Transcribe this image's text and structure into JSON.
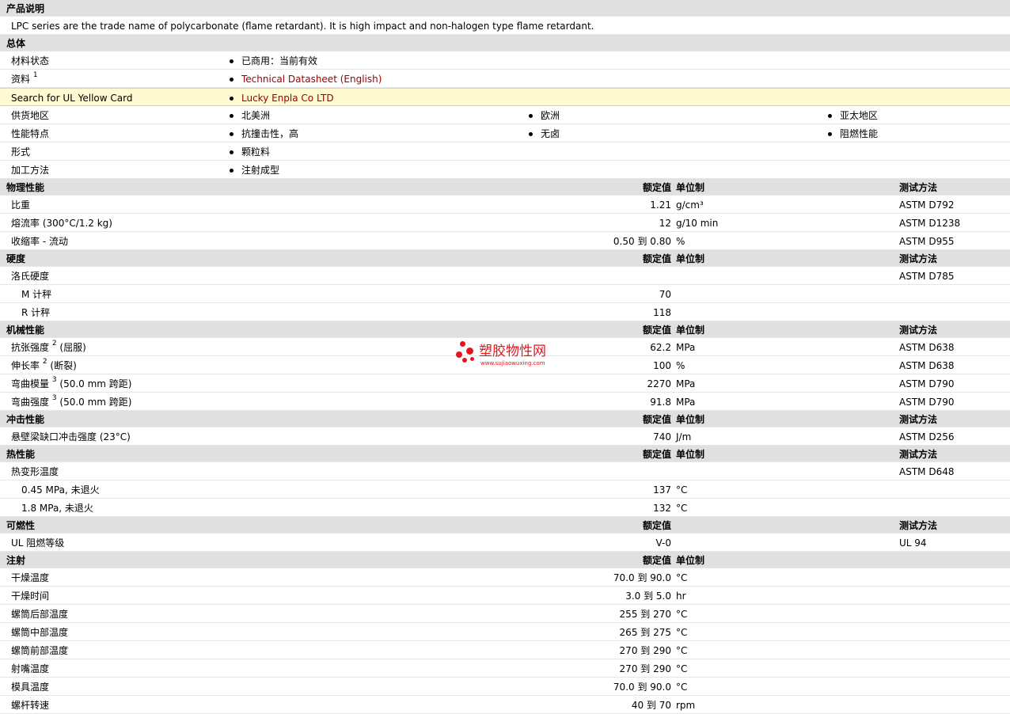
{
  "overview": {
    "title": "产品说明",
    "text": "LPC series are the trade name of polycarbonate (flame retardant). It is high impact and non-halogen type flame retardant."
  },
  "general": {
    "title": "总体",
    "material_status_label": "材料状态",
    "material_status_value": "已商用：当前有效",
    "doc_label": "资料",
    "doc_sup": "1",
    "doc_link": "Technical Datasheet (English)",
    "ul_label": "Search for UL Yellow Card",
    "ul_link": "Lucky Enpla Co LTD",
    "supply_label": "供货地区",
    "supply": [
      "北美洲",
      "欧洲",
      "亚太地区"
    ],
    "features_label": "性能特点",
    "features": [
      "抗撞击性，高",
      "无卤",
      "阻燃性能"
    ],
    "form_label": "形式",
    "form_value": "颗粒料",
    "process_label": "加工方法",
    "process_value": "注射成型"
  },
  "headers": {
    "value": "额定值",
    "unit": "单位制",
    "method": "测试方法"
  },
  "physical": {
    "title": "物理性能",
    "rows": [
      {
        "label": "比重",
        "value": "1.21",
        "unit": "g/cm³",
        "method": "ASTM D792"
      },
      {
        "label": "熔流率  (300°C/1.2 kg)",
        "value": "12",
        "unit": "g/10 min",
        "method": "ASTM D1238"
      },
      {
        "label": "收缩率  - 流动",
        "value": "0.50 到  0.80",
        "unit": "%",
        "method": "ASTM D955"
      }
    ]
  },
  "hardness": {
    "title": "硬度",
    "label": "洛氏硬度",
    "method": "ASTM D785",
    "rows": [
      {
        "label": "M 计秤",
        "value": "70"
      },
      {
        "label": "R 计秤",
        "value": "118"
      }
    ]
  },
  "mechanical": {
    "title": "机械性能",
    "rows": [
      {
        "label": "抗张强度",
        "sup": "2",
        "note": " (屈服)",
        "value": "62.2",
        "unit": "MPa",
        "method": "ASTM D638"
      },
      {
        "label": "伸长率",
        "sup": "2",
        "note": " (断裂)",
        "value": "100",
        "unit": "%",
        "method": "ASTM D638"
      },
      {
        "label": "弯曲模量",
        "sup": "3",
        "note": " (50.0 mm 跨距)",
        "value": "2270",
        "unit": "MPa",
        "method": "ASTM D790"
      },
      {
        "label": "弯曲强度",
        "sup": "3",
        "note": " (50.0 mm 跨距)",
        "value": "91.8",
        "unit": "MPa",
        "method": "ASTM D790"
      }
    ]
  },
  "impact": {
    "title": "冲击性能",
    "rows": [
      {
        "label": "悬壁梁缺口冲击强度  (23°C)",
        "value": "740",
        "unit": "J/m",
        "method": "ASTM D256"
      }
    ]
  },
  "thermal": {
    "title": "热性能",
    "label": "热变形温度",
    "method": "ASTM D648",
    "rows": [
      {
        "label": "0.45 MPa, 未退火",
        "value": "137",
        "unit": "°C"
      },
      {
        "label": "1.8 MPa, 未退火",
        "value": "132",
        "unit": "°C"
      }
    ]
  },
  "flammability": {
    "title": "可燃性",
    "rows": [
      {
        "label": "UL 阻燃等级",
        "value": "V-0",
        "method": "UL 94"
      }
    ]
  },
  "injection": {
    "title": "注射",
    "rows": [
      {
        "label": "干燥温度",
        "value": "70.0 到  90.0",
        "unit": "°C"
      },
      {
        "label": "干燥时间",
        "value": "3.0 到  5.0",
        "unit": "hr"
      },
      {
        "label": "螺筒后部温度",
        "value": "255 到  270",
        "unit": "°C"
      },
      {
        "label": "螺筒中部温度",
        "value": "265 到  275",
        "unit": "°C"
      },
      {
        "label": "螺筒前部温度",
        "value": "270 到  290",
        "unit": "°C"
      },
      {
        "label": "射嘴温度",
        "value": "270 到  290",
        "unit": "°C"
      },
      {
        "label": "模具温度",
        "value": "70.0 到  90.0",
        "unit": "°C"
      },
      {
        "label": "螺杆转速",
        "value": "40 到  70",
        "unit": "rpm"
      }
    ]
  },
  "watermark": {
    "text": "塑胶物性网",
    "url": "www.sujiaowuxing.com",
    "color": "#e8141c"
  },
  "colors": {
    "section_bg": "#e0e0e0",
    "highlight_bg": "#fffad2",
    "link": "#990000"
  }
}
